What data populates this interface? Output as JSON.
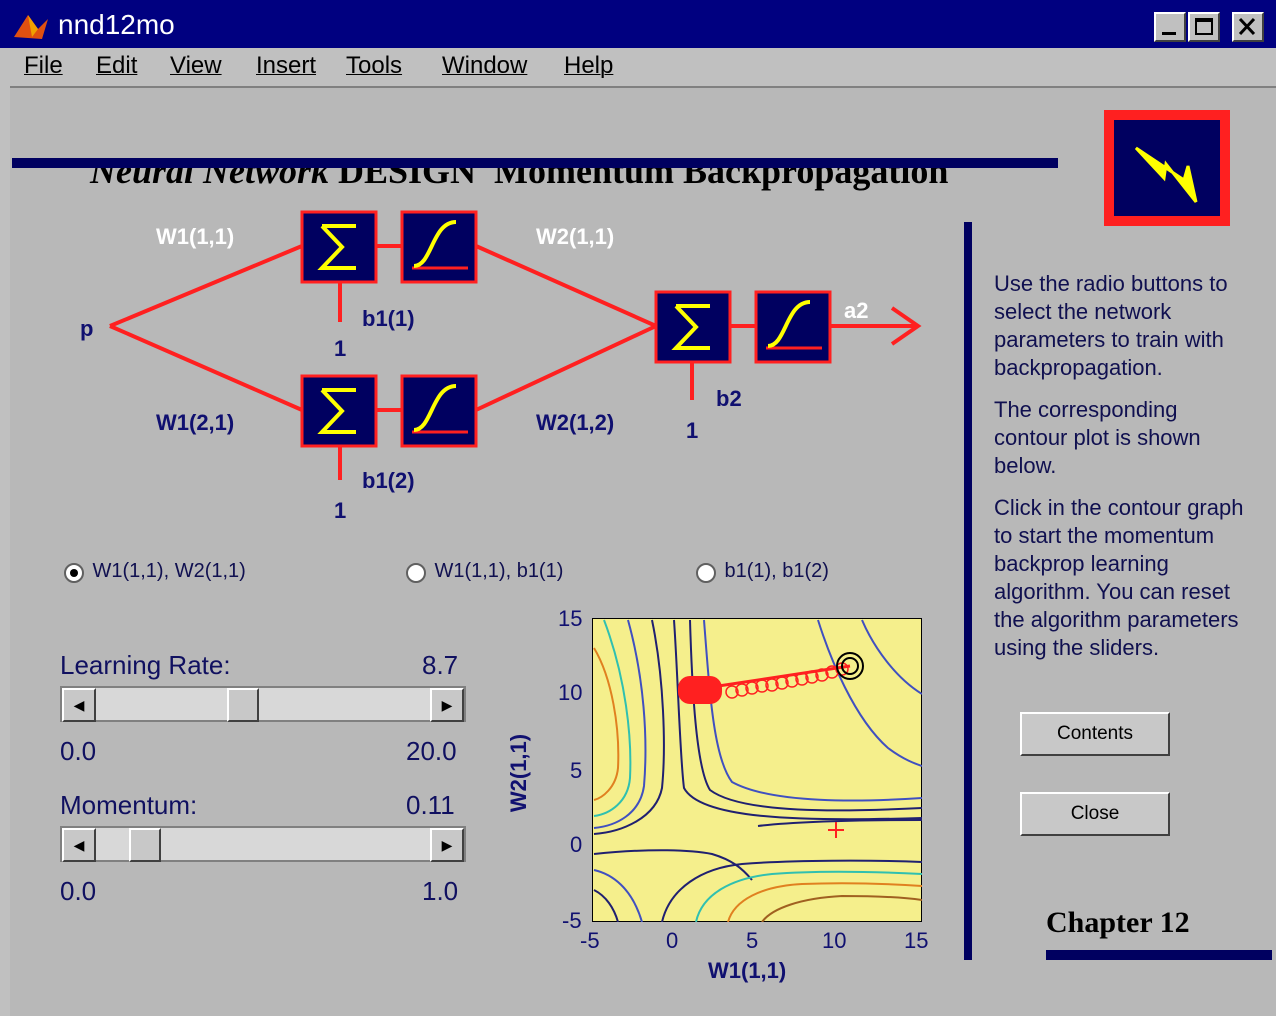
{
  "window": {
    "title": "nnd12mo"
  },
  "menu": [
    "File",
    "Edit",
    "View",
    "Insert",
    "Tools",
    "Window",
    "Help"
  ],
  "banner": {
    "italic": "Neural Network",
    "rest": "DESIGN  Momentum Backpropagation"
  },
  "diagram": {
    "input": "p",
    "w11": "W1(1,1)",
    "w21": "W1(2,1)",
    "w2_11": "W2(1,1)",
    "w2_12": "W2(1,2)",
    "b11": "b1(1)",
    "b12": "b1(2)",
    "b2": "b2",
    "one": "1",
    "output": "a2"
  },
  "radios": [
    {
      "label": "W1(1,1), W2(1,1)",
      "selected": true
    },
    {
      "label": "W1(1,1), b1(1)",
      "selected": false
    },
    {
      "label": "b1(1), b1(2)",
      "selected": false
    }
  ],
  "sliders": {
    "learning_rate": {
      "label": "Learning Rate:",
      "value": "8.7",
      "min": "0.0",
      "max": "20.0",
      "level": 0.435
    },
    "momentum": {
      "label": "Momentum:",
      "value": "0.11",
      "min": "0.0",
      "max": "1.0",
      "level": 0.11
    }
  },
  "plot": {
    "xlabel": "W1(1,1)",
    "ylabel": "W2(1,1)",
    "xticks": [
      "-5",
      "0",
      "5",
      "10",
      "15"
    ],
    "yticks": [
      "15",
      "10",
      "5",
      "0",
      "-5"
    ]
  },
  "info": [
    "Use the radio buttons to select the network parameters to train with backpropagation.",
    "The corresponding contour plot is shown below.",
    "Click in the contour graph to start the momentum backprop learning algorithm. You can reset the algorithm parameters using the sliders."
  ],
  "buttons": {
    "contents": "Contents",
    "close": "Close"
  },
  "chapter": "Chapter 12",
  "colors": {
    "titlebar": "#000080",
    "accent_red": "#ff2020",
    "navy": "#000060",
    "plot_bg": "#f5ef8c"
  }
}
